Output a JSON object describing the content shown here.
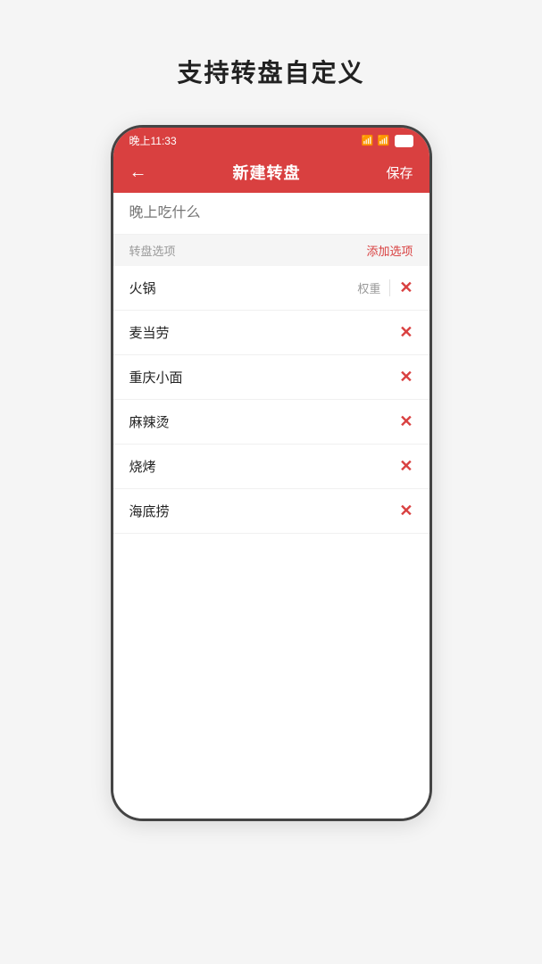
{
  "page": {
    "title": "支持转盘自定义"
  },
  "status_bar": {
    "time": "晚上11:33",
    "signal": "📶",
    "wifi": "WiFi",
    "battery": "89"
  },
  "top_bar": {
    "back_label": "←",
    "title": "新建转盘",
    "save_label": "保存"
  },
  "form": {
    "name_placeholder": "晚上吃什么",
    "section_label": "转盘选项",
    "add_option_label": "添加选项"
  },
  "items": [
    {
      "name": "火锅",
      "has_weight": true,
      "weight_label": "权重"
    },
    {
      "name": "麦当劳",
      "has_weight": false
    },
    {
      "name": "重庆小面",
      "has_weight": false
    },
    {
      "name": "麻辣烫",
      "has_weight": false
    },
    {
      "name": "烧烤",
      "has_weight": false
    },
    {
      "name": "海底捞",
      "has_weight": false
    }
  ]
}
